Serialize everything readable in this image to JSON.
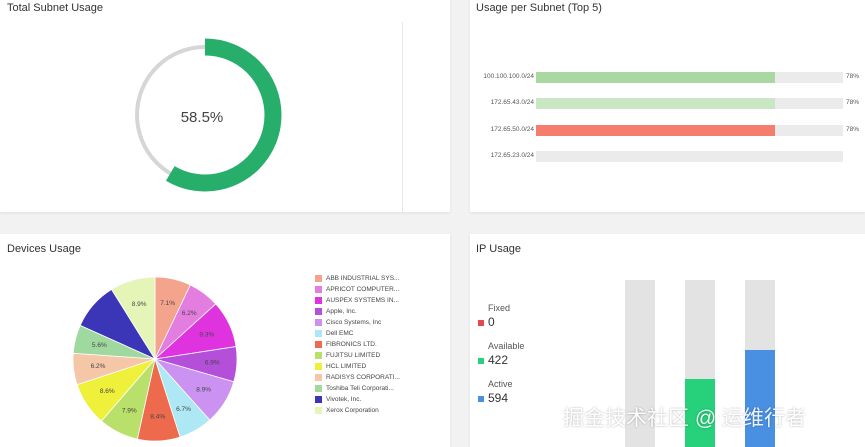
{
  "total": {
    "title": "Total Subnet Usage",
    "value_label": "58.5%",
    "value": 0.585,
    "color": "#27ae6b",
    "track_color": "#d6d6d6"
  },
  "subnet": {
    "title": "Usage per Subnet (Top 5)",
    "rows": [
      {
        "label": "100.100.100.0/24",
        "pct_label": "78%",
        "value": 0.78,
        "color": "#a9d9a0"
      },
      {
        "label": "172.65.43.0/24",
        "pct_label": "78%",
        "value": 0.78,
        "color": "#c9e7c2"
      },
      {
        "label": "172.65.50.0/24",
        "pct_label": "78%",
        "value": 0.78,
        "color": "#f57d6e"
      },
      {
        "label": "172.65.23.0/24",
        "pct_label": "",
        "value": 0,
        "color": "#c9e7c2"
      }
    ]
  },
  "devices": {
    "title": "Devices Usage",
    "legend": [
      {
        "label": "ABB INDUSTRIAL SYS...",
        "color": "#f4a48c"
      },
      {
        "label": "APRICOT COMPUTER...",
        "color": "#e47de0"
      },
      {
        "label": "AUSPEX SYSTEMS IN...",
        "color": "#e033e0"
      },
      {
        "label": "Apple, Inc.",
        "color": "#b34fd8"
      },
      {
        "label": "Cisco Systems, Inc",
        "color": "#cc92f2"
      },
      {
        "label": "Dell EMC",
        "color": "#aee8f5"
      },
      {
        "label": "FIBRONICS LTD.",
        "color": "#ee6a4d"
      },
      {
        "label": "FUJITSU LIMITED",
        "color": "#b9e06a"
      },
      {
        "label": "HCL LIMITED",
        "color": "#eef03a"
      },
      {
        "label": "RADISYS CORPORATI...",
        "color": "#f5c6a8"
      },
      {
        "label": "Toshiba Teli Corporati...",
        "color": "#9fd9a0"
      },
      {
        "label": "Vivotek, Inc.",
        "color": "#3b35b8"
      },
      {
        "label": "Xerox Corporation",
        "color": "#e5f5b8"
      }
    ]
  },
  "chart_data": {
    "type": "pie",
    "labels": [
      "ABB INDUSTRIAL SYS...",
      "APRICOT COMPUTER...",
      "AUSPEX SYSTEMS IN...",
      "Apple, Inc.",
      "Cisco Systems, Inc",
      "Dell EMC",
      "FIBRONICS LTD.",
      "FUJITSU LIMITED",
      "HCL LIMITED",
      "RADISYS CORPORATI...",
      "Toshiba Teli Corporati...",
      "Vivotek, Inc.",
      "Xerox Corporation"
    ],
    "values": [
      7.1,
      6.2,
      9.3,
      6.9,
      8.9,
      6.7,
      8.4,
      7.9,
      8.6,
      6.2,
      5.6,
      9.4,
      8.9
    ],
    "slice_labels": [
      "7.1%",
      "6.2%",
      "9.3%",
      "6.9%",
      "8.9%",
      "6.7%",
      "8.4%",
      "7.9%",
      "8.6%",
      "6.2%",
      "5.6%",
      "",
      "8.9%"
    ],
    "colors": [
      "#f4a48c",
      "#e47de0",
      "#e033e0",
      "#b34fd8",
      "#cc92f2",
      "#aee8f5",
      "#ee6a4d",
      "#b9e06a",
      "#eef03a",
      "#f5c6a8",
      "#9fd9a0",
      "#3b35b8",
      "#e5f5b8"
    ],
    "legend_position": "right"
  },
  "ip": {
    "title": "IP Usage",
    "stats": [
      {
        "label": "Fixed",
        "value": "0",
        "color": "#e5484d",
        "fraction": 0
      },
      {
        "label": "Available",
        "value": "422",
        "color": "#27d07a",
        "fraction": 0.41
      },
      {
        "label": "Active",
        "value": "594",
        "color": "#4a90e2",
        "fraction": 0.58
      }
    ]
  },
  "watermark": "掘金技术社区 @ 运维行者"
}
